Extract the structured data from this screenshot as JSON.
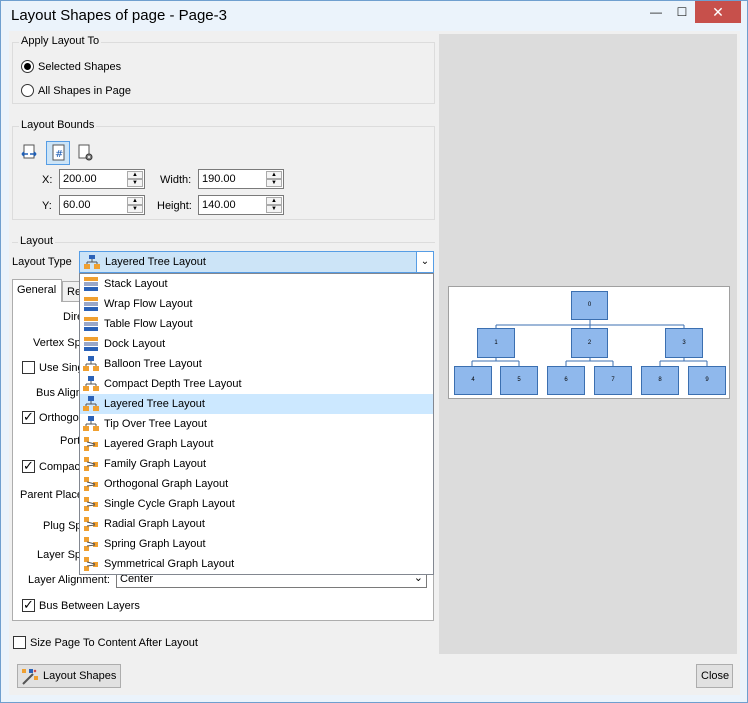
{
  "window": {
    "title": "Layout Shapes of page - Page-3",
    "minimize_glyph": "—",
    "maximize_glyph": "☐",
    "close_glyph": "✕"
  },
  "apply_group": {
    "label": "Apply Layout To",
    "options": [
      {
        "label": "Selected Shapes",
        "checked": true
      },
      {
        "label": "All Shapes in Page",
        "checked": false
      }
    ]
  },
  "bounds_group": {
    "label": "Layout Bounds",
    "icons": [
      "fit-bounds-icon",
      "grid-bounds-icon",
      "page-settings-icon"
    ],
    "x_label": "X:",
    "x_value": "200.00",
    "y_label": "Y:",
    "y_value": "60.00",
    "width_label": "Width:",
    "width_value": "190.00",
    "height_label": "Height:",
    "height_value": "140.00"
  },
  "layout_group": {
    "label": "Layout",
    "type_label": "Layout Type",
    "selected_type": "Layered Tree Layout",
    "dropdown_items": [
      {
        "label": "Stack Layout",
        "icon": "stack-layout-icon"
      },
      {
        "label": "Wrap Flow Layout",
        "icon": "flow-layout-icon"
      },
      {
        "label": "Table Flow Layout",
        "icon": "flow-layout-icon"
      },
      {
        "label": "Dock Layout",
        "icon": "dock-layout-icon"
      },
      {
        "label": "Balloon Tree Layout",
        "icon": "tree-layout-icon"
      },
      {
        "label": "Compact Depth Tree Layout",
        "icon": "tree-layout-icon"
      },
      {
        "label": "Layered Tree Layout",
        "icon": "tree-layout-icon",
        "selected": true
      },
      {
        "label": "Tip Over Tree Layout",
        "icon": "tree-layout-icon"
      },
      {
        "label": "Layered Graph Layout",
        "icon": "graph-layout-icon"
      },
      {
        "label": "Family Graph Layout",
        "icon": "graph-layout-icon"
      },
      {
        "label": "Orthogonal Graph Layout",
        "icon": "graph-layout-icon"
      },
      {
        "label": "Single Cycle Graph Layout",
        "icon": "graph-layout-icon"
      },
      {
        "label": "Radial Graph Layout",
        "icon": "graph-layout-icon"
      },
      {
        "label": "Spring Graph Layout",
        "icon": "graph-layout-icon"
      },
      {
        "label": "Symmetrical Graph Layout",
        "icon": "graph-layout-icon"
      }
    ],
    "tabs": [
      {
        "label": "General",
        "active": true
      },
      {
        "label": "Re",
        "active": false
      }
    ],
    "partial_rows": {
      "direction": "Dire",
      "vertex_spacing": "Vertex Sp",
      "use_single": "Use Sing",
      "bus_align": "Bus Align",
      "orthogonal": "Orthogo",
      "port": "Port",
      "compact": "Compac",
      "parent_place": "Parent Place",
      "plug_spacing": "Plug Sp",
      "layer_spacing": "Layer Sp"
    },
    "layer_alignment_label": "Layer Alignment:",
    "layer_alignment_value": "Center",
    "bus_between_layers_label": "Bus Between Layers",
    "bus_between_layers_checked": true
  },
  "preview": {
    "nodes": [
      "0",
      "1",
      "2",
      "3",
      "4",
      "5",
      "6",
      "7",
      "8",
      "9"
    ]
  },
  "footer": {
    "size_page_label": "Size Page To Content After Layout",
    "size_page_checked": false,
    "layout_button": "Layout Shapes",
    "close_button": "Close"
  }
}
